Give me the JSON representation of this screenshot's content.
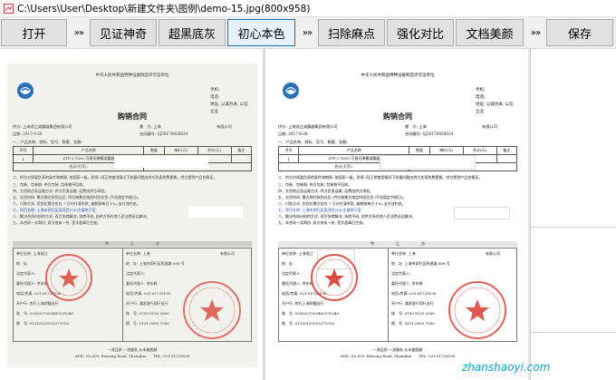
{
  "window": {
    "title": "C:\\Users\\User\\Desktop\\新建文件夹\\图例\\demo-15.jpg(800x958)"
  },
  "toolbar": {
    "open": "打开",
    "sep1": "»»",
    "witness": "见证神奇",
    "black_bg": "超黑底灰",
    "original": "初心本色",
    "sep2": "»»",
    "remove_spots": "扫除麻点",
    "contrast": "强化对比",
    "beautify": "文档美颜",
    "sep3": "»»",
    "save": "保存"
  },
  "document": {
    "header": "中华人民共和国特种设备制造许可证单位",
    "hd_r1": "手机:",
    "hd_r2": "电话:",
    "hd_r3": "地址: 以诚为本, 以信立业",
    "title": "购销合同",
    "supplier": "供方: 上海淞江减震器集团有限公司",
    "no_label": "需　方: 上海",
    "no_right": "有限公司",
    "date": "日期: 2017-9-28",
    "contract_no": "合同编号: SJ20170928024",
    "product_hdr": "一、产品名称、商标、型号、数量、金额:",
    "col1": "序号",
    "col2": "产品名称",
    "col3": "数量",
    "col4": "单价(元)",
    "col5": "合计(元)",
    "col6": "备注",
    "row_no": "1",
    "row_name": "ZTF-2-1600 可调式弹簧减震器",
    "total_label": "合计(大写):",
    "p2": "二、供方对质量负责的条件和期限: 按国家一级、质保: 同正常使用情况下质量问题由供方负责免费更换。供方提供产品合格证。",
    "p3": "三、包装、包装物: 供方包装, 包装物不回收。",
    "p4": "四、交货地点及运输方式: 供方负责运输, 运费由供方承担。",
    "p5": "五、交货时间: 需方预付款到达后, 供方按需方指定时间交货 (不含国定节假日)。",
    "p6": "六、付款方式: 货到后需方应在 7 日内付清余款, 逾期按每日 1‰ 支付违约金。",
    "p7": "七、项目名称: 上海市闵行区某项目(1#)主楼地下室",
    "p8": "八、解决合同纠纷的方式: 双方协商解决; 协商不成, 由供方所在地人民法院诉讼解决。",
    "p9": "九、本合同一式两份, 双方各执一份, 签字盖章后生效。",
    "signature_band": "甲　　　　　　乙　　　　　　方",
    "blk_l1": "单位名称: 上海淞江",
    "blk_l2": "地　址:",
    "blk_l3": "法定代表人:",
    "blk_l4": "委托代理人: 李东辉",
    "blk_l5": "电话/传真: 021-61728190",
    "blk_l6": "开户行: 农行上海闵镇支行",
    "blk_l7": "账　号: 0356327000400131049",
    "blk_l8": "税　号: 91310120553271916",
    "blk_r1": "单位名称: 上海",
    "blk_r1b": "有限公司",
    "blk_r2": "地　址: 上海市闵行区陈昌路 888 号",
    "blk_r3": "法定代表人:",
    "blk_r4": "委托代理人: 李东辉",
    "blk_r5": "电话/传真: 021-61728190",
    "blk_r6": "开户行: 浦发银行闵行支行",
    "blk_r7": "账　号: 9759 8155 2000",
    "blk_r8": "税　号: 9131 0000 7000",
    "footer1": "一流品质 一流服务 从未被超越",
    "footer2": "ADD: No.699, Beisong Road, Shanghai　　TEL: 021-61728190"
  },
  "watermark": "zhanshaoyi.com",
  "colors": {
    "active_border": "#0078d7",
    "stamp_red": "#d9392f",
    "logo_blue": "#2b6fb8"
  }
}
